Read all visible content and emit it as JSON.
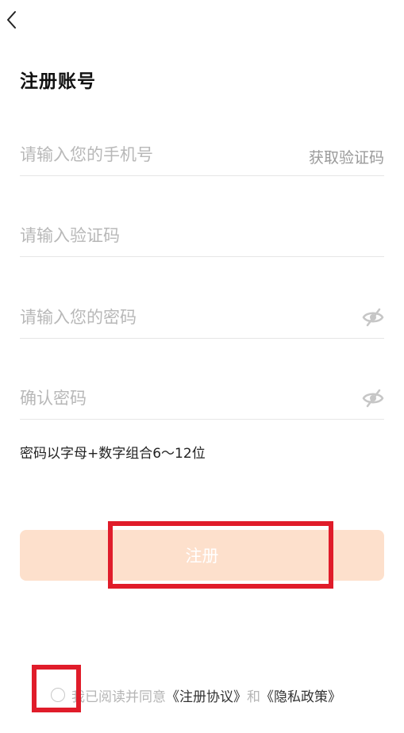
{
  "header": {
    "back_icon": "chevron-left-icon",
    "title": "注册账号"
  },
  "form": {
    "phone_placeholder": "请输入您的手机号",
    "get_code_label": "获取验证码",
    "code_placeholder": "请输入验证码",
    "password_placeholder": "请输入您的密码",
    "confirm_placeholder": "确认密码",
    "eye_icon": "eye-off-icon",
    "hint": "密码以字母+数字组合6～12位"
  },
  "register_button": {
    "label": "注册",
    "color": "#fde0cc"
  },
  "agreement": {
    "prefix": "我已阅读并同意",
    "terms_link": "《注册协议》",
    "and_text": "和",
    "privacy_link": "《隐私政策》"
  },
  "colors": {
    "accent_light": "#fde0cc",
    "highlight": "#e01c2a"
  }
}
